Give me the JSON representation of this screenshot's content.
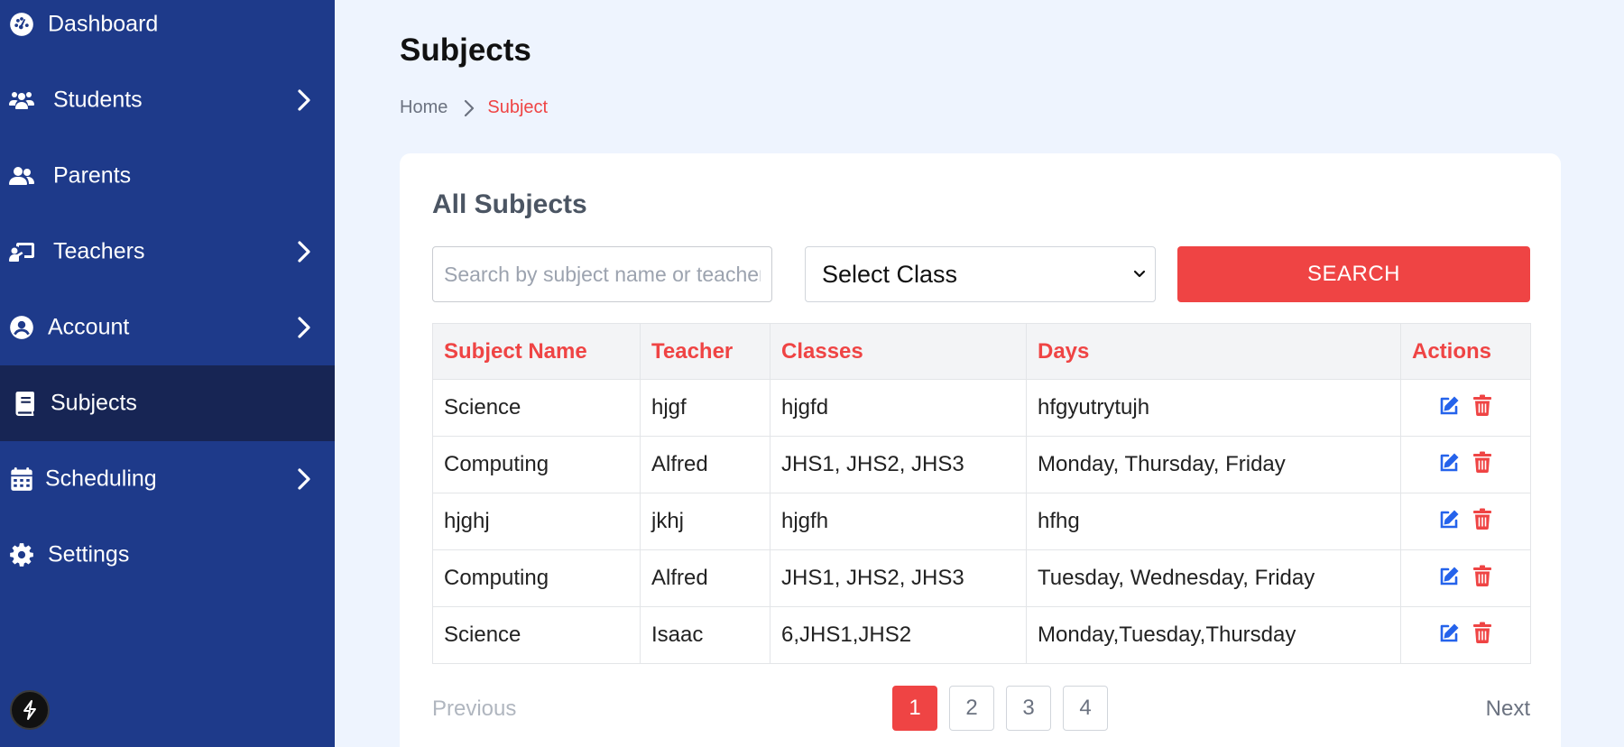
{
  "sidebar": {
    "items": [
      {
        "label": "Dashboard",
        "icon": "dashboard-icon",
        "has_submenu": false,
        "active": false
      },
      {
        "label": "Students",
        "icon": "users-icon",
        "has_submenu": true,
        "active": false
      },
      {
        "label": "Parents",
        "icon": "user-group-icon",
        "has_submenu": false,
        "active": false
      },
      {
        "label": "Teachers",
        "icon": "chalkboard-teacher-icon",
        "has_submenu": true,
        "active": false
      },
      {
        "label": "Account",
        "icon": "user-circle-icon",
        "has_submenu": true,
        "active": false
      },
      {
        "label": "Subjects",
        "icon": "book-icon",
        "has_submenu": false,
        "active": true
      },
      {
        "label": "Scheduling",
        "icon": "calendar-icon",
        "has_submenu": true,
        "active": false
      },
      {
        "label": "Settings",
        "icon": "gear-icon",
        "has_submenu": false,
        "active": false
      }
    ],
    "floating_icon": "bolt-icon"
  },
  "header": {
    "title": "Subjects",
    "breadcrumb": {
      "home": "Home",
      "current": "Subject"
    }
  },
  "card": {
    "title": "All Subjects",
    "search": {
      "placeholder": "Search by subject name or teacher",
      "value": ""
    },
    "select_class": {
      "selected": "Select Class"
    },
    "search_button": "SEARCH"
  },
  "table": {
    "headers": [
      "Subject Name",
      "Teacher",
      "Classes",
      "Days",
      "Actions"
    ],
    "rows": [
      {
        "subject": "Science",
        "teacher": "hjgf",
        "classes": "hjgfd",
        "days": "hfgyutrytujh"
      },
      {
        "subject": "Computing",
        "teacher": "Alfred",
        "classes": "JHS1, JHS2, JHS3",
        "days": "Monday, Thursday, Friday"
      },
      {
        "subject": "hjghj",
        "teacher": "jkhj",
        "classes": "hjgfh",
        "days": "hfhg"
      },
      {
        "subject": "Computing",
        "teacher": "Alfred",
        "classes": "JHS1, JHS2, JHS3",
        "days": "Tuesday, Wednesday, Friday"
      },
      {
        "subject": "Science",
        "teacher": "Isaac",
        "classes": "6,JHS1,JHS2",
        "days": "Monday,Tuesday,Thursday"
      }
    ],
    "action_icons": [
      "edit-icon",
      "trash-icon"
    ]
  },
  "pagination": {
    "previous": "Previous",
    "next": "Next",
    "pages": [
      "1",
      "2",
      "3",
      "4"
    ],
    "current": "1"
  },
  "colors": {
    "sidebar_bg": "#1e3a8a",
    "sidebar_active": "#172554",
    "accent": "#ef4444",
    "edit_icon": "#2563eb",
    "page_bg": "#eef4fe"
  }
}
